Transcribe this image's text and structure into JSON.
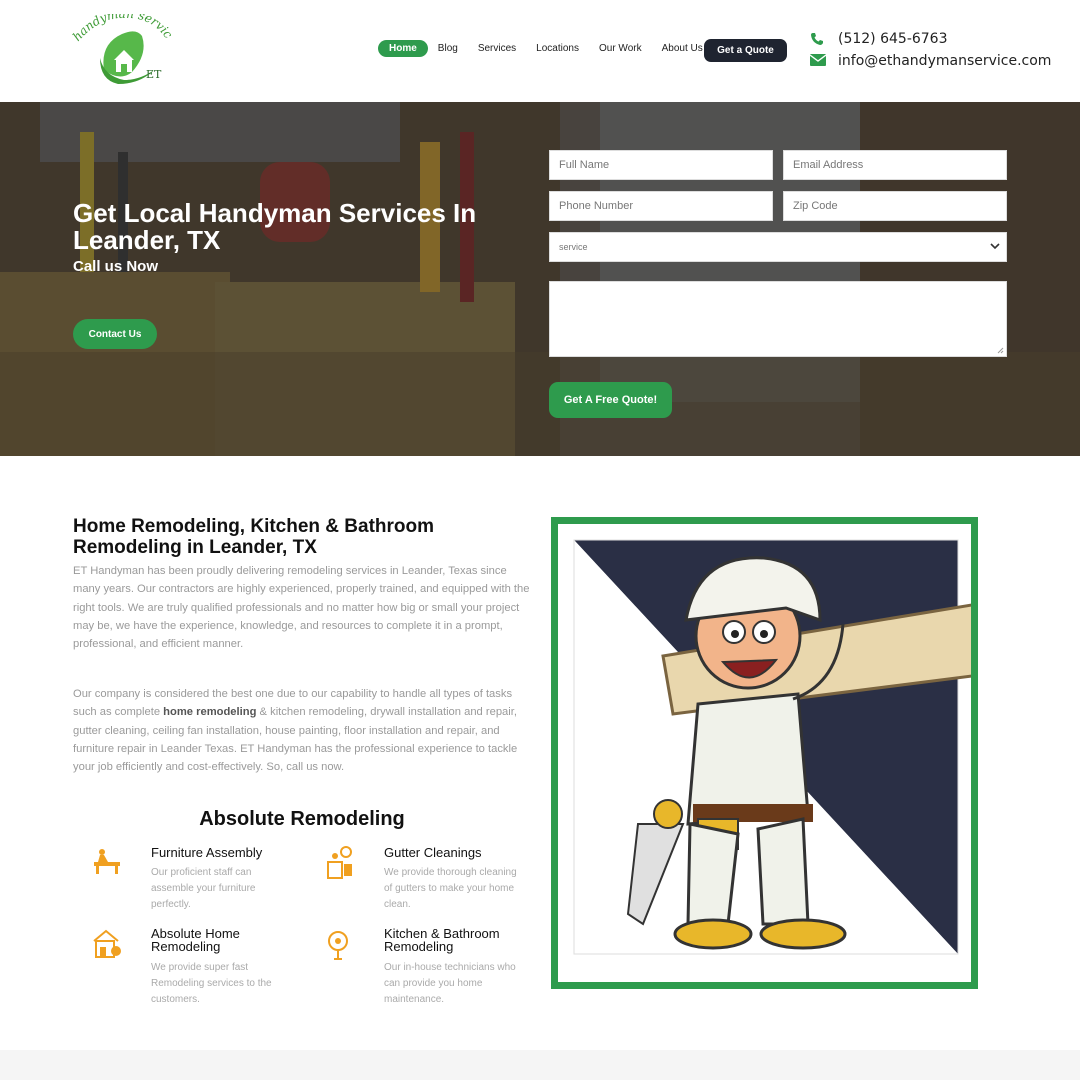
{
  "brand": {
    "logo_text": "handyman service",
    "logo_initials": "ET"
  },
  "nav": {
    "items": [
      "Home",
      "Blog",
      "Services",
      "Locations",
      "Our Work",
      "About Us"
    ],
    "quote_button": "Get a Quote"
  },
  "contact": {
    "phone": "(512) 645-6763",
    "email": "info@ethandymanservice.com"
  },
  "hero": {
    "title": "Get Local Handyman Services In Leander, TX",
    "subtitle": "Call us Now",
    "contact_button": "Contact Us"
  },
  "form": {
    "full_name_placeholder": "Full Name",
    "email_placeholder": "Email Address",
    "phone_placeholder": "Phone Number",
    "zip_placeholder": "Zip Code",
    "service_selected": "service",
    "message_value": "",
    "submit_label": "Get A Free Quote!"
  },
  "main": {
    "title": "Home Remodeling, Kitchen & Bathroom Remodeling in Leander, TX",
    "para1": "ET Handyman has been proudly delivering remodeling services in Leander, Texas since many years. Our contractors are highly experienced, properly trained, and equipped with the right tools. We are truly qualified professionals and no matter how big or small your project may be, we have the experience, knowledge, and resources to complete it in a prompt, professional, and efficient manner.",
    "para2_before": "Our company is considered the best one due to our capability to handle all types of tasks such as complete ",
    "para2_bold": "home remodeling",
    "para2_after": " & kitchen remodeling, drywall installation and repair, gutter cleaning, ceiling fan installation, house painting, floor installation and repair, and furniture repair in Leander Texas. ET Handyman has the professional experience to tackle your job efficiently and cost-effectively. So, call us now.",
    "section_title": "Absolute Remodeling"
  },
  "features": [
    {
      "title": "Furniture Assembly",
      "desc": "Our proficient staff can assemble your furniture perfectly.",
      "icon": "furniture-assembly-icon"
    },
    {
      "title": "Gutter Cleanings",
      "desc": "We provide thorough cleaning of gutters to make your home clean.",
      "icon": "gutter-cleaning-icon"
    },
    {
      "title": "Absolute Home Remodeling",
      "desc": "We provide super fast Remodeling services to the customers.",
      "icon": "home-remodeling-icon"
    },
    {
      "title": "Kitchen & Bathroom Remodeling",
      "desc": "Our in-house technicians who can provide you home maintenance.",
      "icon": "kitchen-remodeling-icon"
    }
  ],
  "colors": {
    "accent": "#2e9b4d",
    "dark": "#1f2430",
    "icon_orange": "#f0a020"
  }
}
